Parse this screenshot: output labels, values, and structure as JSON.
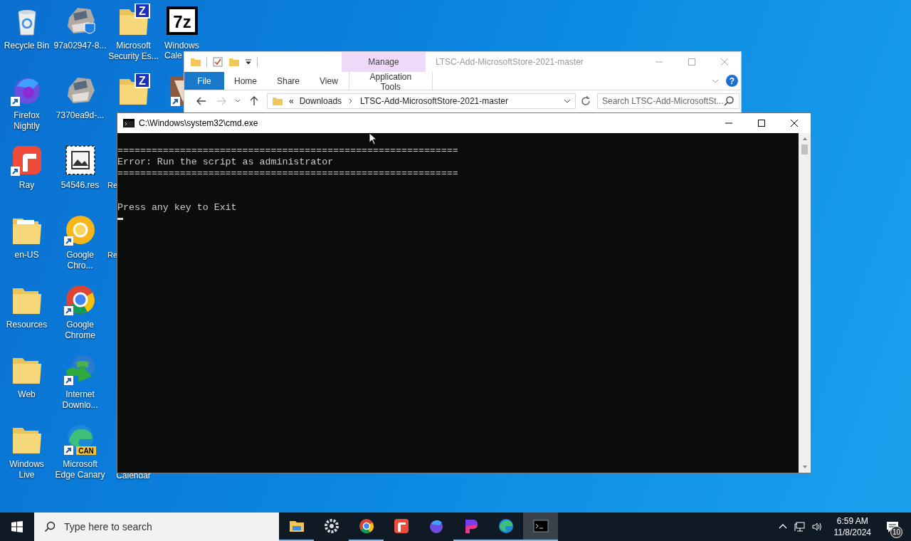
{
  "desktop": {
    "columns": [
      [
        {
          "kind": "recycle-bin",
          "label": [
            "Recycle Bin"
          ]
        },
        {
          "kind": "firefox",
          "label": [
            "Firefox",
            "Nightly"
          ],
          "shortcut": true
        },
        {
          "kind": "ray",
          "label": [
            "Ray"
          ],
          "shortcut": true
        },
        {
          "kind": "folder-page",
          "label": [
            "en-US"
          ]
        },
        {
          "kind": "folder",
          "label": [
            "Resources"
          ]
        },
        {
          "kind": "folder",
          "label": [
            "Web"
          ]
        },
        {
          "kind": "folder",
          "label": [
            "Windows",
            "Live"
          ]
        }
      ],
      [
        {
          "kind": "installer-shield",
          "label": [
            "97a02947-8..."
          ]
        },
        {
          "kind": "installer",
          "label": [
            "7370ea9d-..."
          ]
        },
        {
          "kind": "image-file",
          "label": [
            "54546.res"
          ]
        },
        {
          "kind": "chrome-canary",
          "label": [
            "Google",
            "Chro..."
          ],
          "shortcut": true
        },
        {
          "kind": "chrome",
          "label": [
            "Google",
            "Chrome"
          ],
          "shortcut": true
        },
        {
          "kind": "idm",
          "label": [
            "Internet",
            "Downlo..."
          ],
          "shortcut": true
        },
        {
          "kind": "edge-canary",
          "label": [
            "Microsoft",
            "Edge Canary"
          ],
          "shortcut": true,
          "badge": "CAN"
        }
      ],
      [
        {
          "kind": "zip-folder",
          "glyph": "Z",
          "label": [
            "Microsoft",
            "Security Es..."
          ]
        },
        {
          "kind": "zip-folder",
          "glyph": "Z"
        },
        {
          "kind": "none",
          "label": [
            "Re"
          ],
          "cut": true
        },
        {
          "kind": "none",
          "label": [
            "Re"
          ],
          "cut": true
        },
        {
          "kind": "empty"
        },
        {
          "kind": "empty"
        },
        {
          "kind": "covered",
          "label": [
            "Calendar"
          ]
        }
      ],
      [
        {
          "kind": "sevenzip",
          "glyph": "7z",
          "label": [
            "Windows",
            "Cale"
          ],
          "cut": true
        },
        {
          "kind": "media",
          "shortcut": true
        }
      ]
    ]
  },
  "explorer": {
    "title": "LTSC-Add-MicrosoftStore-2021-master",
    "context_header": "Manage",
    "tabs": [
      {
        "label": "File",
        "kind": "file"
      },
      {
        "label": "Home",
        "kind": "tab"
      },
      {
        "label": "Share",
        "kind": "tab"
      },
      {
        "label": "View",
        "kind": "tab"
      },
      {
        "label": "Application Tools",
        "kind": "contextual"
      }
    ],
    "help": "?",
    "nav": {
      "forward_disabled": true
    },
    "address": {
      "overflow": "«",
      "path": [
        "Downloads",
        "LTSC-Add-MicrosoftStore-2021-master"
      ]
    },
    "search": {
      "placeholder": "Search LTSC-Add-MicrosoftSt..."
    }
  },
  "cmd": {
    "title": "C:\\Windows\\system32\\cmd.exe",
    "cursor": true,
    "lines": [
      {
        "kind": "blank"
      },
      {
        "kind": "text",
        "text": "============================================================"
      },
      {
        "kind": "text",
        "text": "Error: Run the script as administrator"
      },
      {
        "kind": "text",
        "text": "============================================================"
      },
      {
        "kind": "blank"
      },
      {
        "kind": "blank"
      },
      {
        "kind": "text",
        "text": "Press any key to Exit"
      }
    ]
  },
  "taskbar": {
    "search": {
      "placeholder": "Type here to search"
    },
    "apps": [
      {
        "kind": "explorer",
        "running": true,
        "active": false
      },
      {
        "kind": "settings",
        "running": false,
        "active": false
      },
      {
        "kind": "chrome",
        "running": true,
        "active": false
      },
      {
        "kind": "ray",
        "running": false,
        "active": false
      },
      {
        "kind": "firefox",
        "running": false,
        "active": false
      },
      {
        "kind": "paint",
        "running": true,
        "active": false
      },
      {
        "kind": "edge",
        "running": true,
        "active": false
      },
      {
        "kind": "cmd",
        "running": true,
        "active": true
      }
    ],
    "clock": {
      "time": "6:59 AM",
      "date": "11/8/2024"
    },
    "notifications": {
      "count": "10"
    }
  }
}
